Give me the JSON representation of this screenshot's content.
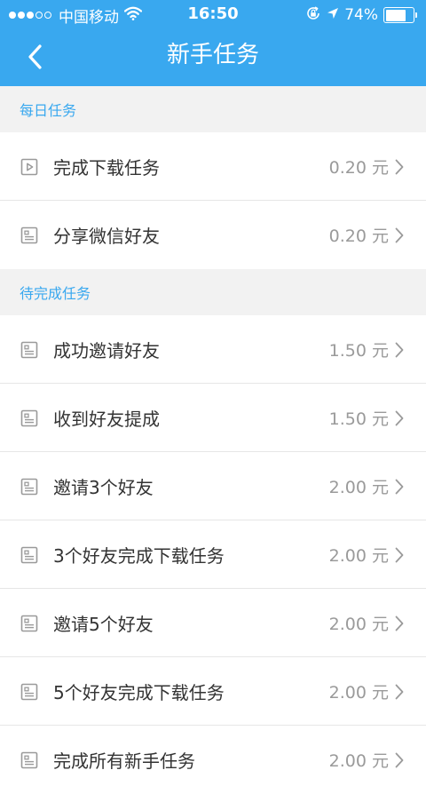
{
  "status_bar": {
    "carrier": "中国移动",
    "time": "16:50",
    "battery_percent": "74%",
    "battery_level": 0.74,
    "signal_bars_filled": 3,
    "signal_bars_total": 5
  },
  "nav": {
    "title": "新手任务",
    "back_icon": "chevron-left-icon"
  },
  "theme": {
    "primary": "#39a8ef",
    "section_text": "#39a8ef",
    "background": "#f2f2f2",
    "reward_text": "#9a9a9a"
  },
  "sections": [
    {
      "title": "每日任务",
      "tasks": [
        {
          "icon": "video-icon",
          "label": "完成下载任务",
          "reward": "0.20",
          "unit": "元"
        },
        {
          "icon": "document-icon",
          "label": "分享微信好友",
          "reward": "0.20",
          "unit": "元"
        }
      ]
    },
    {
      "title": "待完成任务",
      "tasks": [
        {
          "icon": "document-icon",
          "label": "成功邀请好友",
          "reward": "1.50",
          "unit": "元"
        },
        {
          "icon": "document-icon",
          "label": "收到好友提成",
          "reward": "1.50",
          "unit": "元"
        },
        {
          "icon": "document-icon",
          "label": "邀请3个好友",
          "reward": "2.00",
          "unit": "元"
        },
        {
          "icon": "document-icon",
          "label": "3个好友完成下载任务",
          "reward": "2.00",
          "unit": "元"
        },
        {
          "icon": "document-icon",
          "label": "邀请5个好友",
          "reward": "2.00",
          "unit": "元"
        },
        {
          "icon": "document-icon",
          "label": "5个好友完成下载任务",
          "reward": "2.00",
          "unit": "元"
        },
        {
          "icon": "document-icon",
          "label": "完成所有新手任务",
          "reward": "2.00",
          "unit": "元"
        }
      ]
    }
  ]
}
